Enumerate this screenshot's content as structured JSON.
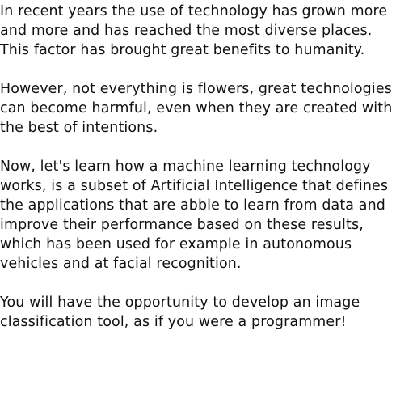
{
  "paragraphs": [
    "In recent years the use of technology has grown more and more and has reached the most diverse places. This factor has brought great benefits to humanity.",
    "However, not everything is flowers, great technologies can become harmful, even when they are created with the best of intentions.",
    "Now, let's learn how a machine learning technology works, is a subset of Artificial Intelligence that defines the applications that are abble to learn from data and improve their performance based on these results, which has been used for example in autonomous vehicles and at facial recognition.",
    "You will have the opportunity to develop an image classification tool, as if you were a programmer!"
  ]
}
